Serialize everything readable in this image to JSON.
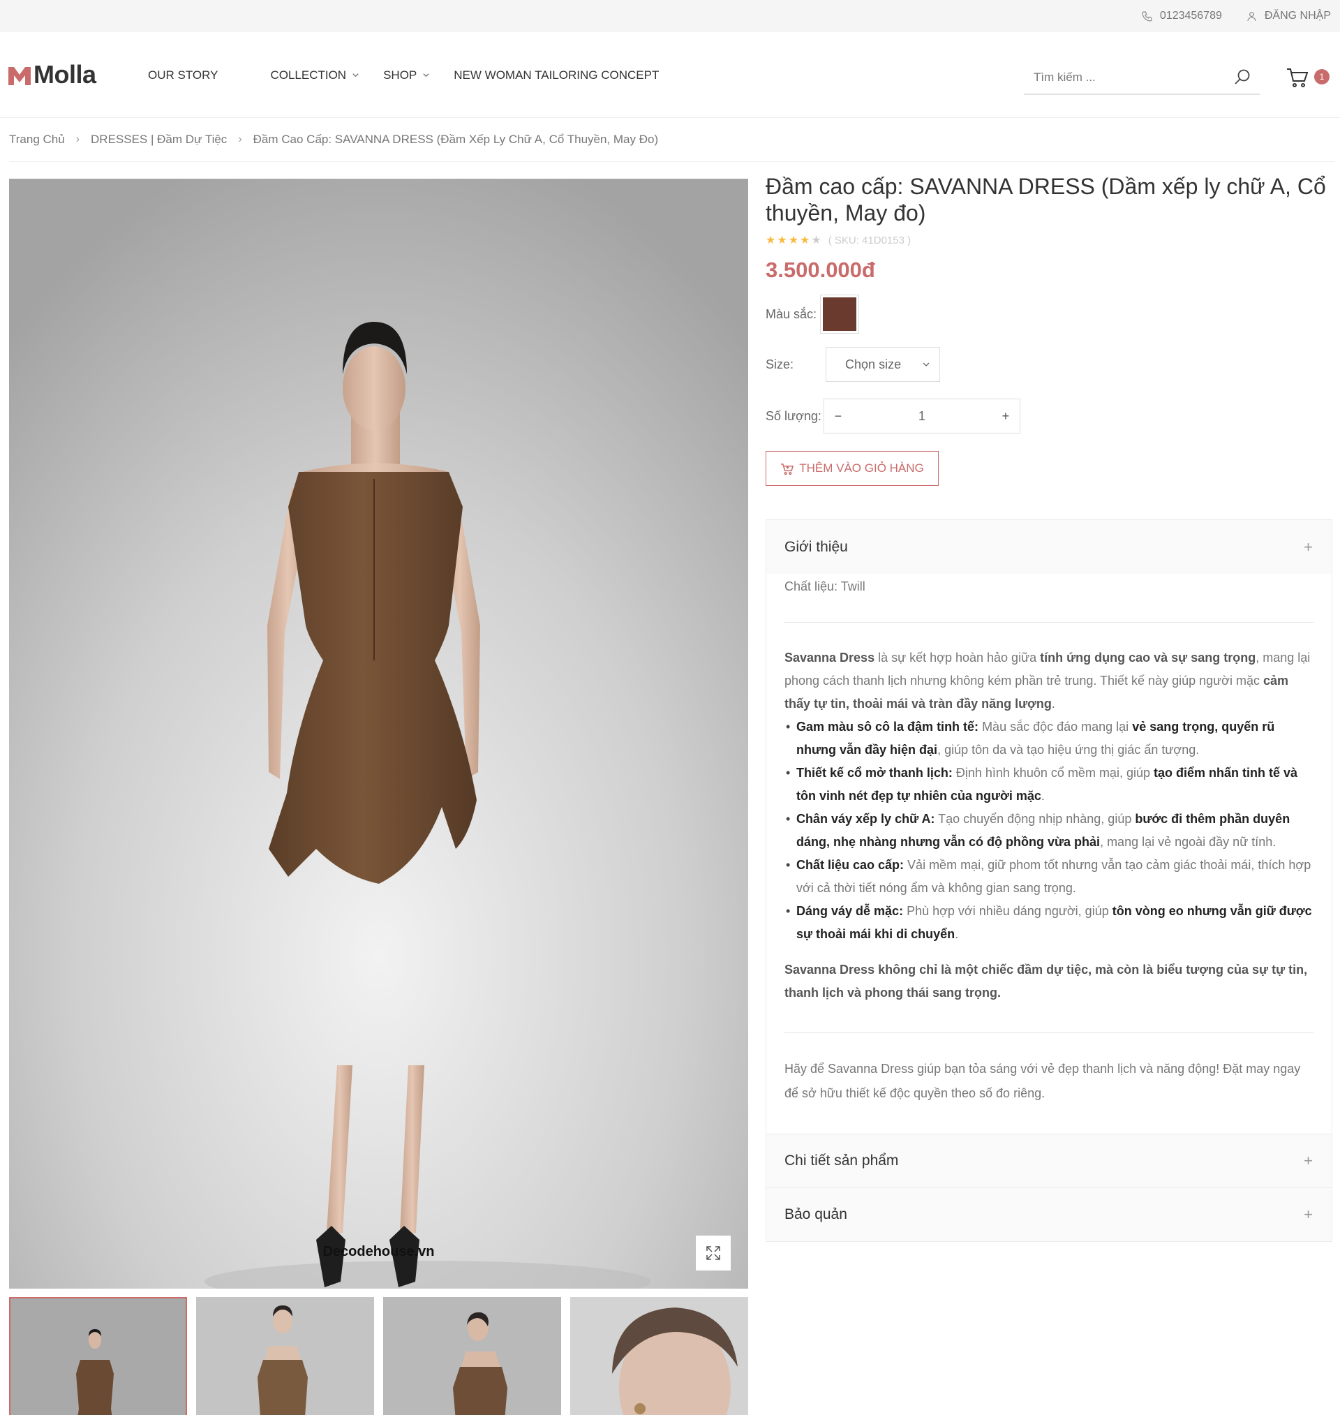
{
  "topbar": {
    "phone": "0123456789",
    "login": "ĐĂNG NHẬP"
  },
  "header": {
    "logo_text": "Molla",
    "nav": [
      {
        "label": "OUR STORY"
      },
      {
        "label": "COLLECTION"
      },
      {
        "label": "SHOP"
      },
      {
        "label": "NEW WOMAN TAILORING CONCEPT"
      }
    ],
    "search_placeholder": "Tìm kiếm ...",
    "cart_count": "1"
  },
  "breadcrumb": [
    "Trang Chủ",
    "DRESSES | Đầm Dự Tiệc",
    "Đầm Cao Cấp: SAVANNA DRESS (Đầm Xếp Ly Chữ A, Cổ Thuyền, May Đo)"
  ],
  "gallery": {
    "watermark": "Decodehouse.vn"
  },
  "product": {
    "title": "Đầm cao cấp: SAVANNA DRESS (Dầm xếp ly chữ A, Cổ thuyền, May đo)",
    "rating": 4,
    "rating_max": 5,
    "sku": "( SKU: 41D0153 )",
    "price": "3.500.000đ",
    "color_label": "Màu sắc:",
    "color_hex": "#6b3a2e",
    "size_label": "Size:",
    "size_select": "Chọn size",
    "qty_label": "Số lượng:",
    "qty_value": "1",
    "qty_minus": "−",
    "qty_plus": "+",
    "add_to_cart": "THÊM VÀO GIỎ HÀNG"
  },
  "accordion": {
    "intro_title": "Giới thiệu",
    "material": "Chất liệu: Twill",
    "desc_p1_a": "Savanna Dress",
    "desc_p1_b": " là sự kết hợp hoàn hảo giữa ",
    "desc_p1_c": "tính ứng dụng cao và sự sang trọng",
    "desc_p1_d": ", mang lại phong cách thanh lịch nhưng không kém phần trẻ trung. Thiết kế này giúp người mặc ",
    "desc_p1_e": "cảm thấy tự tin, thoải mái và tràn đầy năng lượng",
    "desc_p1_f": ".",
    "bullets": [
      {
        "a": "Gam màu sô cô la đậm tinh tế:",
        "b": " Màu sắc độc đáo mang lại ",
        "c": "vẻ sang trọng, quyến rũ nhưng vẫn đầy hiện đại",
        "d": ", giúp tôn da và tạo hiệu ứng thị giác ấn tượng."
      },
      {
        "a": "Thiết kế cổ mở thanh lịch:",
        "b": " Định hình khuôn cổ mềm mại, giúp ",
        "c": "tạo điểm nhấn tinh tế và tôn vinh nét đẹp tự nhiên của người mặc",
        "d": "."
      },
      {
        "a": "Chân váy xếp ly chữ A:",
        "b": " Tạo chuyển động nhịp nhàng, giúp ",
        "c": "bước đi thêm phần duyên dáng, nhẹ nhàng nhưng vẫn có độ phồng vừa phải",
        "d": ", mang lại vẻ ngoài đầy nữ tính."
      },
      {
        "a": "Chất liệu cao cấp:",
        "b": " Vải mềm mại, giữ phom tốt nhưng vẫn tạo cảm giác thoải mái, thích hợp với cả thời tiết nóng ẩm và không gian sang trọng.",
        "c": "",
        "d": ""
      },
      {
        "a": "Dáng váy dễ mặc:",
        "b": " Phù hợp với nhiều dáng người, giúp ",
        "c": "tôn vòng eo nhưng vẫn giữ được sự thoải mái khi di chuyển",
        "d": "."
      }
    ],
    "closing": "Savanna Dress không chỉ là một chiếc đầm dự tiệc, mà còn là biểu tượng của sự tự tin, thanh lịch và phong thái sang trọng.",
    "outro": "Hãy để Savanna Dress giúp bạn tỏa sáng với vẻ đẹp thanh lịch và năng động! Đặt may ngay để sở hữu thiết kế độc quyền theo số đo riêng.",
    "details_title": "Chi tiết sản phẩm",
    "care_title": "Bảo quản",
    "plus": "+"
  },
  "colors": {
    "accent": "#c96b6b",
    "dress": "#6b4a32"
  }
}
